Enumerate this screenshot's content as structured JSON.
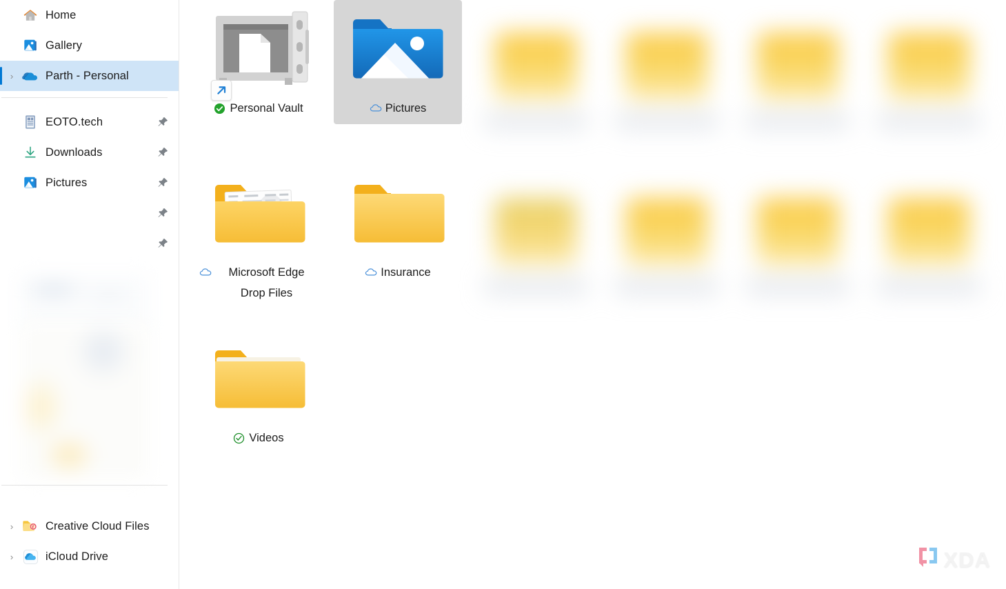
{
  "sidebar": {
    "nav": [
      {
        "label": "Home",
        "icon": "home-icon",
        "expander": false,
        "selected": false,
        "pinned": false
      },
      {
        "label": "Gallery",
        "icon": "gallery-icon",
        "expander": false,
        "selected": false,
        "pinned": false
      },
      {
        "label": "Parth - Personal",
        "icon": "onedrive-icon",
        "expander": true,
        "selected": true,
        "pinned": false
      }
    ],
    "pinned": [
      {
        "label": "EOTO.tech",
        "icon": "document-icon",
        "pinned": true
      },
      {
        "label": "Downloads",
        "icon": "download-icon",
        "pinned": true
      },
      {
        "label": "Pictures",
        "icon": "pictures-icon",
        "pinned": true
      },
      {
        "label": "",
        "icon": "blurred-icon",
        "pinned": true
      },
      {
        "label": "",
        "icon": "blurred-icon",
        "pinned": true
      }
    ],
    "drives": [
      {
        "label": "Creative Cloud Files",
        "icon": "creative-cloud-folder-icon",
        "expander": true
      },
      {
        "label": "iCloud Drive",
        "icon": "icloud-icon",
        "expander": true
      }
    ]
  },
  "files": [
    {
      "name": "Personal Vault",
      "icon": "vault-icon",
      "status": "synced-filled",
      "shortcut": true,
      "selected": false
    },
    {
      "name": "Pictures",
      "icon": "pictures-folder-icon",
      "status": "cloud-only",
      "shortcut": false,
      "selected": true
    },
    {
      "name": "Microsoft Edge Drop Files",
      "icon": "folder-docs-icon",
      "status": "cloud-only",
      "shortcut": false,
      "selected": false
    },
    {
      "name": "Insurance",
      "icon": "folder-icon",
      "status": "cloud-only",
      "shortcut": false,
      "selected": false
    },
    {
      "name": "Videos",
      "icon": "folder-icon",
      "status": "synced-outline",
      "shortcut": false,
      "selected": false
    }
  ],
  "watermark": {
    "text": "XDA",
    "mark": "xda-bracket-logo"
  },
  "colors": {
    "selection_blue": "#cfe4f7",
    "accent_blue": "#0078d4",
    "folder_yellow": "#fbc93f",
    "sync_green": "#22a02b",
    "tile_selected_gray": "#d6d6d6",
    "cloud_outline": "#4a90d9"
  }
}
